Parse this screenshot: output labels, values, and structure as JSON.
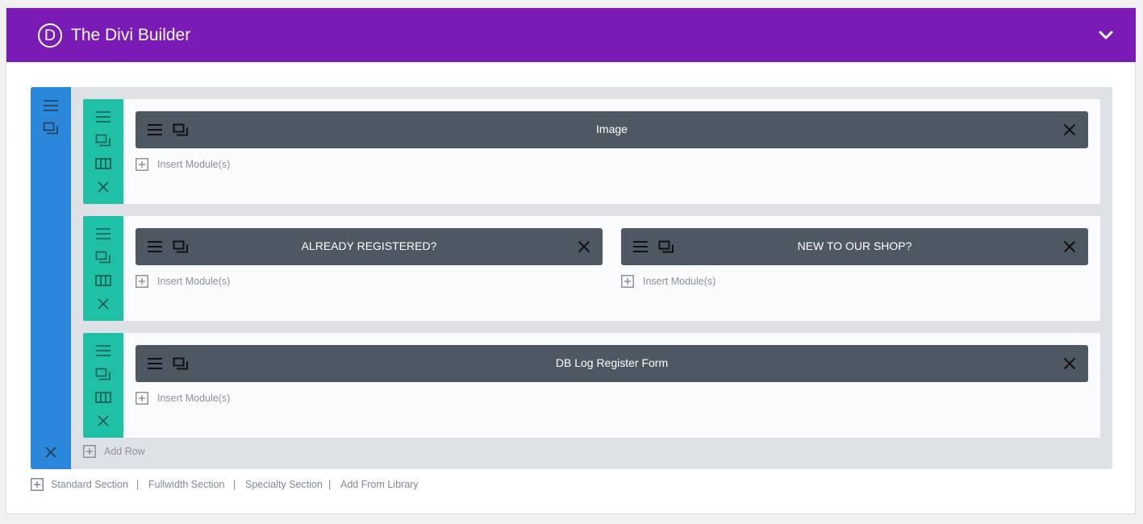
{
  "header": {
    "logo_letter": "D",
    "title": "The Divi Builder"
  },
  "colors": {
    "header_bg": "#7a1bb5",
    "section_bar": "#2b87da",
    "row_bar": "#1fc0a5",
    "module_bg": "#4d5862",
    "section_bg": "#dee2e6"
  },
  "rows": [
    {
      "modules": [
        {
          "label": "Image"
        }
      ],
      "insert_label": "Insert Module(s)"
    },
    {
      "modules": [
        {
          "label": "ALREADY REGISTERED?"
        },
        {
          "label": "NEW TO OUR SHOP?"
        }
      ],
      "insert_label": "Insert Module(s)"
    },
    {
      "modules": [
        {
          "label": "DB Log Register Form"
        }
      ],
      "insert_label": "Insert Module(s)"
    }
  ],
  "add_row_label": "Add Row",
  "footer": {
    "standard": "Standard Section",
    "fullwidth": "Fullwidth Section",
    "specialty": "Specialty Section",
    "library": "Add From Library",
    "separator": "|"
  },
  "icons": [
    "hamburger-icon",
    "clone-icon",
    "columns-icon",
    "close-icon",
    "plus-box-icon",
    "chevron-down-icon"
  ]
}
